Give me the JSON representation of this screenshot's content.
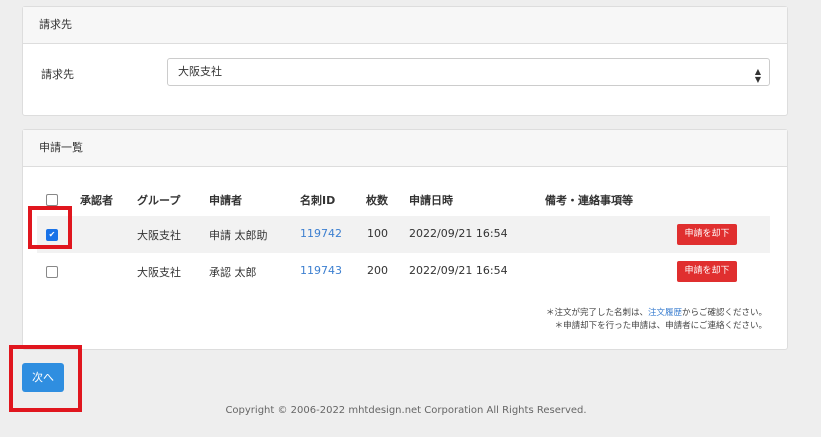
{
  "billing": {
    "header": "請求先",
    "label": "請求先",
    "selected": "大阪支社"
  },
  "applications": {
    "header": "申請一覧",
    "columns": [
      "承認者",
      "グループ",
      "申請者",
      "名刺ID",
      "枚数",
      "申請日時",
      "備考・連絡事項等"
    ],
    "rows": [
      {
        "checked": true,
        "approver": "",
        "group": "大阪支社",
        "applicant": "申請 太郎助",
        "card_id": "119742",
        "count": "100",
        "date": "2022/09/21 16:54",
        "notes": "",
        "reject_label": "申請を却下"
      },
      {
        "checked": false,
        "approver": "",
        "group": "大阪支社",
        "applicant": "承認 太郎",
        "card_id": "119743",
        "count": "200",
        "date": "2022/09/21 16:54",
        "notes": "",
        "reject_label": "申請を却下"
      }
    ],
    "note1_prefix": "＊注文が完了した名刺は、",
    "note1_link": "注文履歴",
    "note1_suffix": "からご確認ください。",
    "note2": "＊申請却下を行った申請は、申請者にご連絡ください。"
  },
  "next_label": "次へ",
  "copyright": "Copyright © 2006-2022 mhtdesign.net Corporation All Rights Reserved.",
  "colors": {
    "accent": "#2f8ee0",
    "danger": "#e02f2f",
    "highlight": "#e0161e"
  }
}
